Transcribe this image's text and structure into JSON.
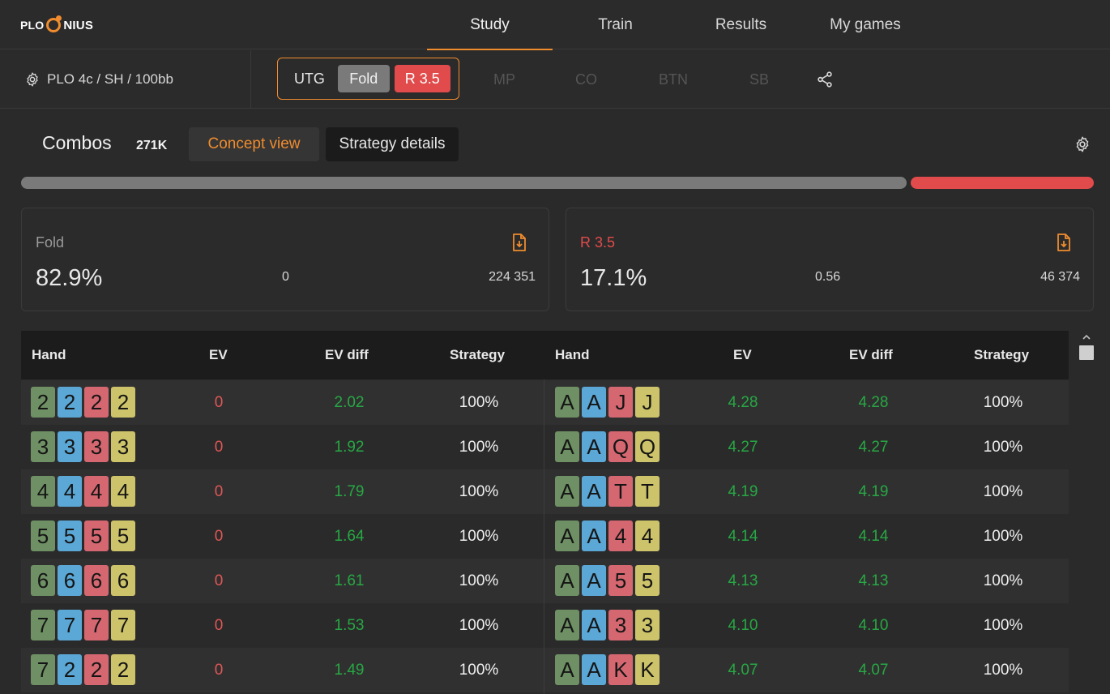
{
  "app": {
    "logo_plo": "PLO",
    "logo_rest": "NIUS"
  },
  "nav": {
    "tabs": [
      {
        "label": "Study",
        "active": true
      },
      {
        "label": "Train",
        "active": false
      },
      {
        "label": "Results",
        "active": false
      },
      {
        "label": "My games",
        "active": false
      }
    ]
  },
  "posbar": {
    "game_settings": "PLO 4c / SH / 100bb",
    "current_position": "UTG",
    "actions": [
      "Fold",
      "R 3.5"
    ],
    "other_positions": [
      "MP",
      "CO",
      "BTN",
      "SB"
    ]
  },
  "combos": {
    "title": "Combos",
    "count": "271K",
    "concept_view": "Concept view",
    "strategy_details": "Strategy details"
  },
  "strategy_split": {
    "fold_fraction": 0.829,
    "raise_fraction": 0.171
  },
  "action_cards": [
    {
      "label": "Fold",
      "pct": "82.9%",
      "ev": "0",
      "combos": "224 351",
      "color": "#9a9a9a"
    },
    {
      "label": "R 3.5",
      "pct": "17.1%",
      "ev": "0.56",
      "combos": "46 374",
      "color": "#e14b4b"
    }
  ],
  "table": {
    "headers": [
      "Hand",
      "EV",
      "EV diff",
      "Strategy"
    ],
    "left": [
      {
        "cards": [
          "2",
          "2",
          "2",
          "2"
        ],
        "ev": "0",
        "ev_diff": "2.02",
        "strategy": "100%"
      },
      {
        "cards": [
          "3",
          "3",
          "3",
          "3"
        ],
        "ev": "0",
        "ev_diff": "1.92",
        "strategy": "100%"
      },
      {
        "cards": [
          "4",
          "4",
          "4",
          "4"
        ],
        "ev": "0",
        "ev_diff": "1.79",
        "strategy": "100%"
      },
      {
        "cards": [
          "5",
          "5",
          "5",
          "5"
        ],
        "ev": "0",
        "ev_diff": "1.64",
        "strategy": "100%"
      },
      {
        "cards": [
          "6",
          "6",
          "6",
          "6"
        ],
        "ev": "0",
        "ev_diff": "1.61",
        "strategy": "100%"
      },
      {
        "cards": [
          "7",
          "7",
          "7",
          "7"
        ],
        "ev": "0",
        "ev_diff": "1.53",
        "strategy": "100%"
      },
      {
        "cards": [
          "7",
          "2",
          "2",
          "2"
        ],
        "ev": "0",
        "ev_diff": "1.49",
        "strategy": "100%"
      }
    ],
    "right": [
      {
        "cards": [
          "A",
          "A",
          "J",
          "J"
        ],
        "ev": "4.28",
        "ev_diff": "4.28",
        "strategy": "100%"
      },
      {
        "cards": [
          "A",
          "A",
          "Q",
          "Q"
        ],
        "ev": "4.27",
        "ev_diff": "4.27",
        "strategy": "100%"
      },
      {
        "cards": [
          "A",
          "A",
          "T",
          "T"
        ],
        "ev": "4.19",
        "ev_diff": "4.19",
        "strategy": "100%"
      },
      {
        "cards": [
          "A",
          "A",
          "4",
          "4"
        ],
        "ev": "4.14",
        "ev_diff": "4.14",
        "strategy": "100%"
      },
      {
        "cards": [
          "A",
          "A",
          "5",
          "5"
        ],
        "ev": "4.13",
        "ev_diff": "4.13",
        "strategy": "100%"
      },
      {
        "cards": [
          "A",
          "A",
          "3",
          "3"
        ],
        "ev": "4.10",
        "ev_diff": "4.10",
        "strategy": "100%"
      },
      {
        "cards": [
          "A",
          "A",
          "K",
          "K"
        ],
        "ev": "4.07",
        "ev_diff": "4.07",
        "strategy": "100%"
      }
    ]
  },
  "icons": {
    "settings": "gear-icon",
    "share": "share-icon",
    "export": "file-export-icon",
    "scroll_up": "chevron-up-icon"
  },
  "colors": {
    "accent": "#f08c2e",
    "fold": "#7a7a7a",
    "raise": "#e14b4b",
    "ev_positive": "#27a844",
    "ev_zero": "#e05656"
  }
}
